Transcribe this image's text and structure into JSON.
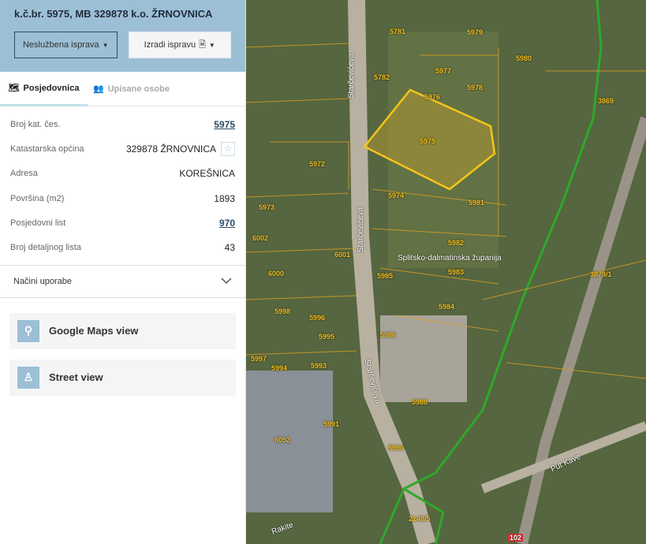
{
  "header": {
    "title": "k.č.br. 5975, MB 329878 k.o. ŽRNOVNICA",
    "btn_unofficial": "Neslužbena isprava",
    "btn_create": "Izradi ispravu"
  },
  "tabs": [
    {
      "label": "Posjedovnica"
    },
    {
      "label": "Upisane osobe"
    }
  ],
  "details": [
    {
      "label": "Broj kat. čes.",
      "value": "5975"
    },
    {
      "label": "Katastarska općina",
      "value": "329878 ŽRNOVNICA"
    },
    {
      "label": "Adresa",
      "value": "KOREŠNICA"
    },
    {
      "label": "Površina (m2)",
      "value": "1893"
    },
    {
      "label": "Posjedovni list",
      "value": "970"
    },
    {
      "label": "Broj detaljnog lista",
      "value": "43"
    }
  ],
  "accordion": {
    "label": "Načini uporabe"
  },
  "links": [
    {
      "label": "Google Maps view"
    },
    {
      "label": "Street view"
    }
  ],
  "map": {
    "labels": {
      "county": "Splitsko-dalmatinska županija",
      "street1": "Starčevićeva",
      "street2": "Starčevićeva",
      "street3": "Starčevićeva",
      "street4": "Put Kave",
      "street5": "Rakite"
    },
    "parcels": [
      "5975",
      "5974",
      "5981",
      "5982",
      "5983",
      "5984",
      "5985",
      "5986",
      "5972",
      "5973",
      "6002",
      "6001",
      "6000",
      "5998",
      "5996",
      "5995",
      "5997",
      "5994",
      "5993",
      "5991",
      "5990",
      "5988",
      "6052",
      "5980",
      "5977",
      "5979",
      "5978",
      "5976",
      "5781",
      "5782",
      "3879/1",
      "3869",
      "2148/5",
      "102"
    ]
  }
}
